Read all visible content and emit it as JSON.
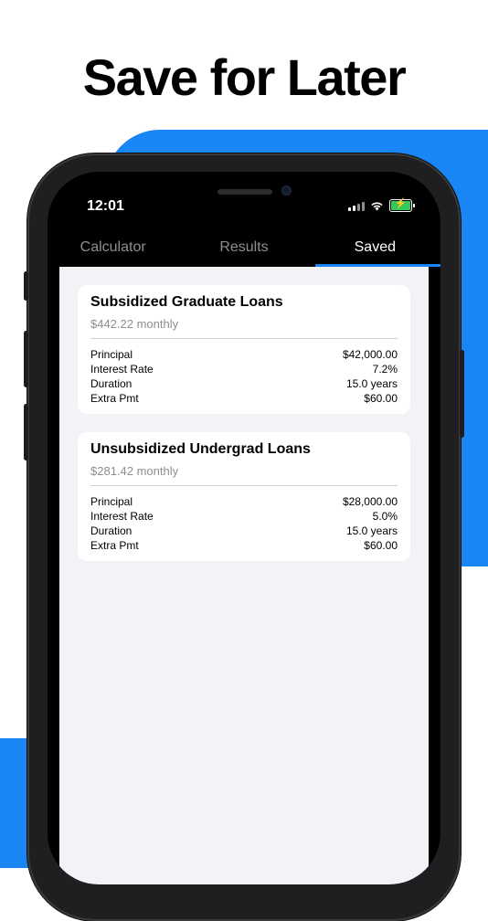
{
  "headline": "Save for Later",
  "status_bar": {
    "time": "12:01"
  },
  "tabs": [
    {
      "label": "Calculator",
      "active": false
    },
    {
      "label": "Results",
      "active": false
    },
    {
      "label": "Saved",
      "active": true
    }
  ],
  "saved_loans": [
    {
      "title": "Subsidized Graduate Loans",
      "monthly": "$442.22 monthly",
      "rows": [
        {
          "label": "Principal",
          "value": "$42,000.00"
        },
        {
          "label": "Interest Rate",
          "value": "7.2%"
        },
        {
          "label": "Duration",
          "value": "15.0 years"
        },
        {
          "label": "Extra Pmt",
          "value": "$60.00"
        }
      ]
    },
    {
      "title": "Unsubsidized Undergrad Loans",
      "monthly": "$281.42 monthly",
      "rows": [
        {
          "label": "Principal",
          "value": "$28,000.00"
        },
        {
          "label": "Interest Rate",
          "value": "5.0%"
        },
        {
          "label": "Duration",
          "value": "15.0 years"
        },
        {
          "label": "Extra Pmt",
          "value": "$60.00"
        }
      ]
    }
  ],
  "colors": {
    "accent": "#1a86f5",
    "background": "#f2f2f7",
    "battery": "#34c759"
  },
  "icons": [
    "signal-icon",
    "wifi-icon",
    "battery-icon",
    "bolt-icon"
  ]
}
